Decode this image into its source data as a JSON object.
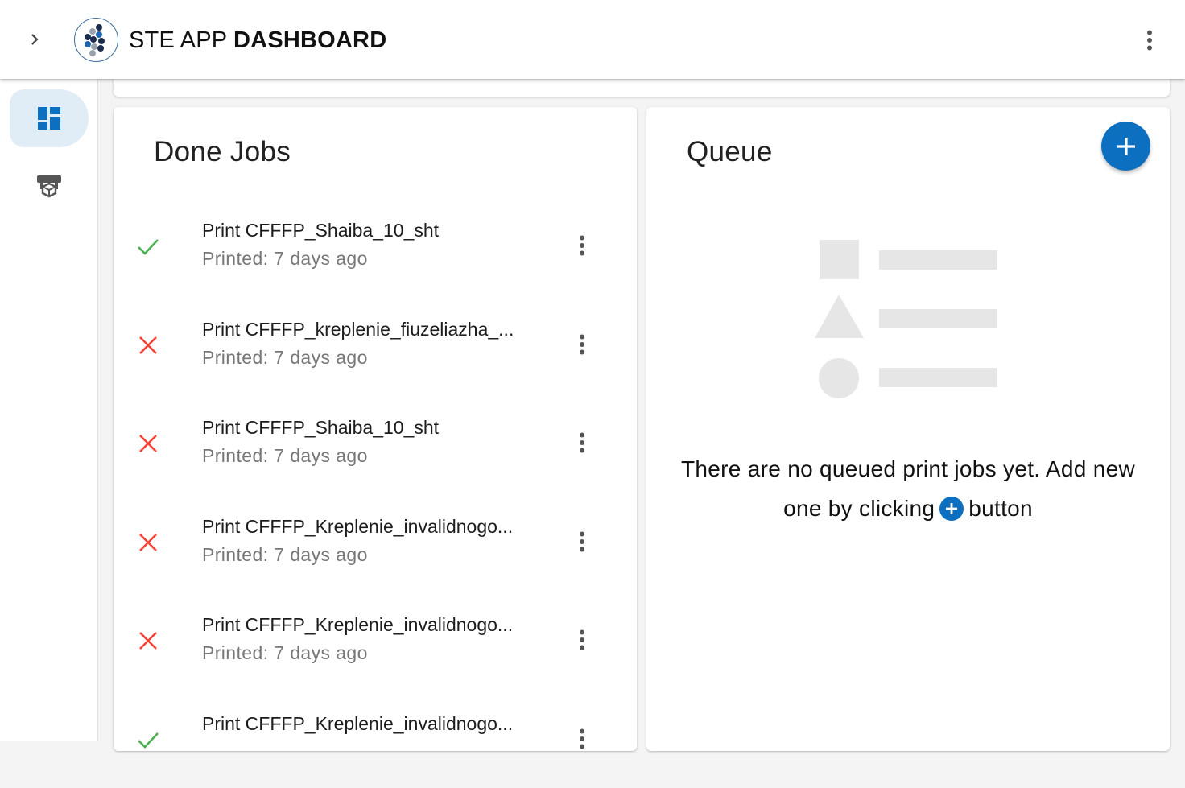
{
  "app": {
    "title_prefix": "STE APP",
    "title_bold": "DASHBOARD"
  },
  "icons": {
    "expand": "chevron-right-icon",
    "more": "more-vert-icon",
    "dashboard": "dashboard-icon",
    "printer": "printer-3d-icon",
    "success": "check-icon",
    "failed": "close-icon",
    "add": "plus-icon"
  },
  "colors": {
    "accent": "#0d6fbf",
    "success": "#4caf50",
    "error": "#f44336",
    "rail_active": "#e0ecf6"
  },
  "done_jobs": {
    "title": "Done Jobs",
    "items": [
      {
        "name": "Print CFFFP_Shaiba_10_sht",
        "printed": "Printed: 7 days ago",
        "status": "success"
      },
      {
        "name": "Print CFFFP_kreplenie_fiuzeliazha_...",
        "printed": "Printed: 7 days ago",
        "status": "failed"
      },
      {
        "name": "Print CFFFP_Shaiba_10_sht",
        "printed": "Printed: 7 days ago",
        "status": "failed"
      },
      {
        "name": "Print CFFFP_Kreplenie_invalidnogo...",
        "printed": "Printed: 7 days ago",
        "status": "failed"
      },
      {
        "name": "Print CFFFP_Kreplenie_invalidnogo...",
        "printed": "Printed: 7 days ago",
        "status": "failed"
      },
      {
        "name": "Print CFFFP_Kreplenie_invalidnogo...",
        "printed": "",
        "status": "success"
      }
    ]
  },
  "queue": {
    "title": "Queue",
    "empty_text_before": "There are no queued print jobs yet. Add new one by clicking",
    "empty_text_after": "button"
  }
}
